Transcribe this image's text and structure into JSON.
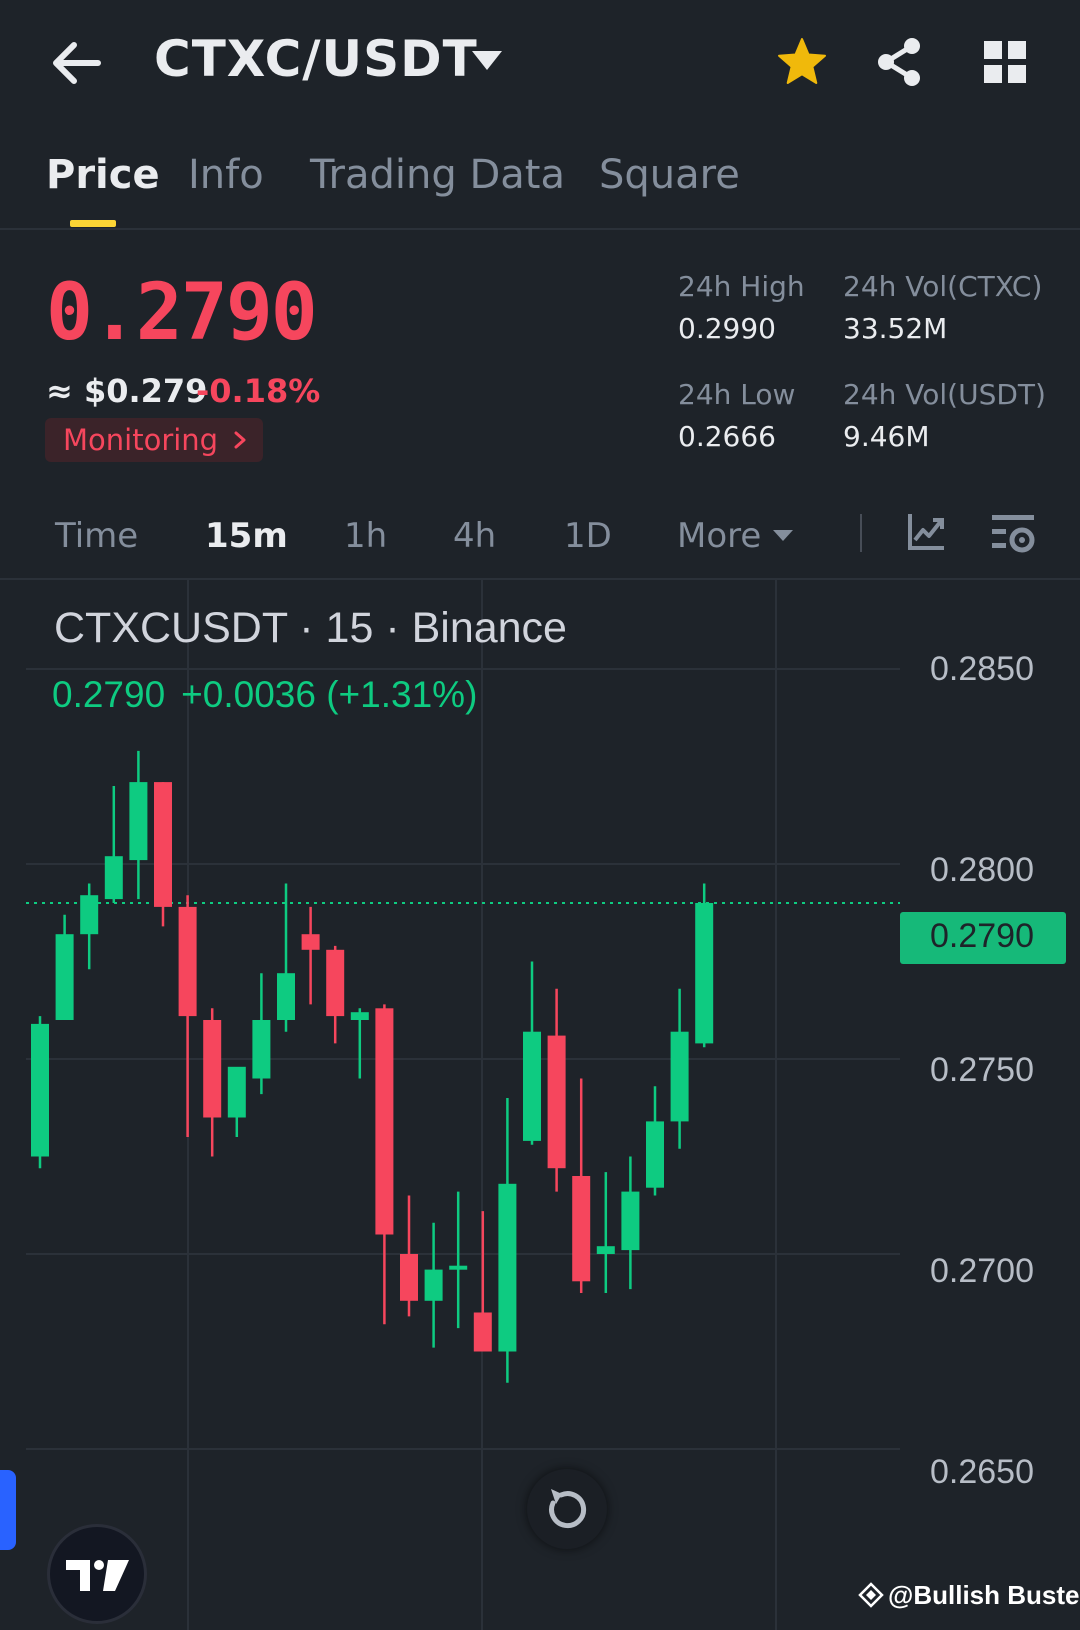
{
  "header": {
    "pair": "CTXC/USDT",
    "icons": [
      "back-arrow-icon",
      "caret-down-icon",
      "star-icon",
      "share-icon",
      "grid-icon"
    ]
  },
  "tabs": [
    {
      "label": "Price",
      "active": true
    },
    {
      "label": "Info",
      "active": false
    },
    {
      "label": "Trading Data",
      "active": false
    },
    {
      "label": "Square",
      "active": false
    }
  ],
  "ticker": {
    "last_price": "0.2790",
    "approx_usd": "≈ $0.279",
    "change_pct": "-0.18%",
    "monitoring_label": "Monitoring",
    "stats": {
      "high_label": "24h High",
      "high_value": "0.2990",
      "low_label": "24h Low",
      "low_value": "0.2666",
      "vol_base_label": "24h Vol(CTXC)",
      "vol_base_value": "33.52M",
      "vol_quote_label": "24h Vol(USDT)",
      "vol_quote_value": "9.46M"
    }
  },
  "intervals": {
    "items": [
      "Time",
      "15m",
      "1h",
      "4h",
      "1D",
      "More"
    ],
    "active": "15m"
  },
  "chart": {
    "symbol_line": "CTXCUSDT · 15 · Binance",
    "ohlc_price": "0.2790",
    "ohlc_change": "+0.0036 (+1.31%)",
    "y_ticks": [
      "0.2850",
      "0.2800",
      "0.2750",
      "0.2700",
      "0.2650"
    ],
    "current_price_tag": "0.2790",
    "watermark": "@Bullish Buster",
    "colors": {
      "up": "#0ecb81",
      "down": "#f6465d",
      "accent": "#fcd535",
      "background": "#1e2329"
    }
  },
  "chart_data": {
    "type": "candlestick",
    "title": "CTXCUSDT · 15 · Binance",
    "ylim": [
      0.2645,
      0.2865
    ],
    "yticks": [
      0.285,
      0.28,
      0.275,
      0.27,
      0.265
    ],
    "last_price": 0.279,
    "grid": true,
    "candles": [
      {
        "o": 0.2725,
        "h": 0.2761,
        "l": 0.2722,
        "c": 0.2759
      },
      {
        "o": 0.276,
        "h": 0.2787,
        "l": 0.276,
        "c": 0.2782
      },
      {
        "o": 0.2782,
        "h": 0.2795,
        "l": 0.2773,
        "c": 0.2792
      },
      {
        "o": 0.2791,
        "h": 0.282,
        "l": 0.279,
        "c": 0.2802
      },
      {
        "o": 0.2801,
        "h": 0.2829,
        "l": 0.2791,
        "c": 0.2821
      },
      {
        "o": 0.2821,
        "h": 0.2821,
        "l": 0.2784,
        "c": 0.2789
      },
      {
        "o": 0.2789,
        "h": 0.2792,
        "l": 0.273,
        "c": 0.2761
      },
      {
        "o": 0.276,
        "h": 0.2763,
        "l": 0.2725,
        "c": 0.2735
      },
      {
        "o": 0.2735,
        "h": 0.2747,
        "l": 0.273,
        "c": 0.2748
      },
      {
        "o": 0.2745,
        "h": 0.2772,
        "l": 0.2741,
        "c": 0.276
      },
      {
        "o": 0.276,
        "h": 0.2795,
        "l": 0.2757,
        "c": 0.2772
      },
      {
        "o": 0.2782,
        "h": 0.2789,
        "l": 0.2764,
        "c": 0.2778
      },
      {
        "o": 0.2778,
        "h": 0.2779,
        "l": 0.2754,
        "c": 0.2761
      },
      {
        "o": 0.276,
        "h": 0.2763,
        "l": 0.2745,
        "c": 0.2762
      },
      {
        "o": 0.2763,
        "h": 0.2764,
        "l": 0.2682,
        "c": 0.2705
      },
      {
        "o": 0.27,
        "h": 0.2715,
        "l": 0.2684,
        "c": 0.2688
      },
      {
        "o": 0.2688,
        "h": 0.2708,
        "l": 0.2676,
        "c": 0.2696
      },
      {
        "o": 0.2697,
        "h": 0.2716,
        "l": 0.2681,
        "c": 0.2697
      },
      {
        "o": 0.2685,
        "h": 0.2711,
        "l": 0.2682,
        "c": 0.2675
      },
      {
        "o": 0.2675,
        "h": 0.274,
        "l": 0.2667,
        "c": 0.2718
      },
      {
        "o": 0.2729,
        "h": 0.2775,
        "l": 0.2728,
        "c": 0.2757
      },
      {
        "o": 0.2756,
        "h": 0.2768,
        "l": 0.2716,
        "c": 0.2722
      },
      {
        "o": 0.272,
        "h": 0.2745,
        "l": 0.269,
        "c": 0.2693
      },
      {
        "o": 0.27,
        "h": 0.2721,
        "l": 0.269,
        "c": 0.2702
      },
      {
        "o": 0.2701,
        "h": 0.2725,
        "l": 0.2691,
        "c": 0.2716
      },
      {
        "o": 0.2717,
        "h": 0.2743,
        "l": 0.2715,
        "c": 0.2734
      },
      {
        "o": 0.2734,
        "h": 0.2768,
        "l": 0.2727,
        "c": 0.2757
      },
      {
        "o": 0.2754,
        "h": 0.2795,
        "l": 0.2753,
        "c": 0.279
      }
    ]
  }
}
